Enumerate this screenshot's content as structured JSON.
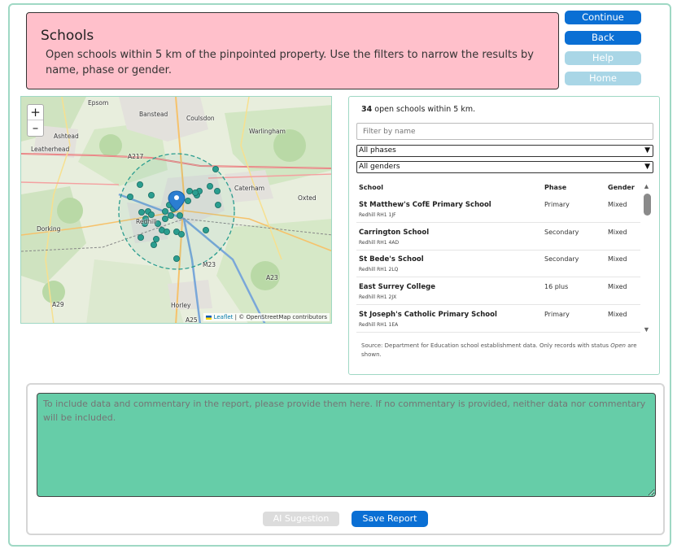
{
  "header": {
    "title": "Schools",
    "description": "Open schools within 5 km of the pinpointed property. Use the filters to narrow the results by name, phase or gender."
  },
  "nav": {
    "continue": "Continue",
    "back": "Back",
    "help": "Help",
    "home": "Home"
  },
  "map": {
    "zoom_in": "+",
    "zoom_out": "–",
    "attribution_leaflet": "Leaflet",
    "attribution_rest": "| © OpenStreetMap contributors",
    "places": [
      "Epsom",
      "Banstead",
      "Coulsdon",
      "Warlingham",
      "Ashtead",
      "Leatherhead",
      "Caterham",
      "Oxted",
      "Dorking",
      "Redhill",
      "Horley",
      "A217",
      "M23",
      "A23",
      "A29",
      "A25"
    ],
    "accent_color": "#2a9d8f"
  },
  "results": {
    "count": "34",
    "count_text": "open schools within 5 km.",
    "filter_placeholder": "Filter by name",
    "phase_select": "All phases",
    "gender_select": "All genders",
    "columns": {
      "school": "School",
      "phase": "Phase",
      "gender": "Gender"
    },
    "rows": [
      {
        "name": "St Matthew's CofE Primary School",
        "address": "Redhill RH1 1JF",
        "phase": "Primary",
        "gender": "Mixed"
      },
      {
        "name": "Carrington School",
        "address": "Redhill RH1 4AD",
        "phase": "Secondary",
        "gender": "Mixed"
      },
      {
        "name": "St Bede's School",
        "address": "Redhill RH1 2LQ",
        "phase": "Secondary",
        "gender": "Mixed"
      },
      {
        "name": "East Surrey College",
        "address": "Redhill RH1 2JX",
        "phase": "16 plus",
        "gender": "Mixed"
      },
      {
        "name": "St Joseph's Catholic Primary School",
        "address": "Redhill RH1 1EA",
        "phase": "Primary",
        "gender": "Mixed"
      }
    ],
    "source_prefix": "Source: Department for Education school establishment data. Only records with status ",
    "source_status": "Open",
    "source_suffix": " are shown."
  },
  "commentary": {
    "placeholder": "To include data and commentary in the report, please provide them here. If no commentary is provided, neither data nor commentary will be included.",
    "ai_button": "AI Sugestion",
    "save_button": "Save Report"
  }
}
